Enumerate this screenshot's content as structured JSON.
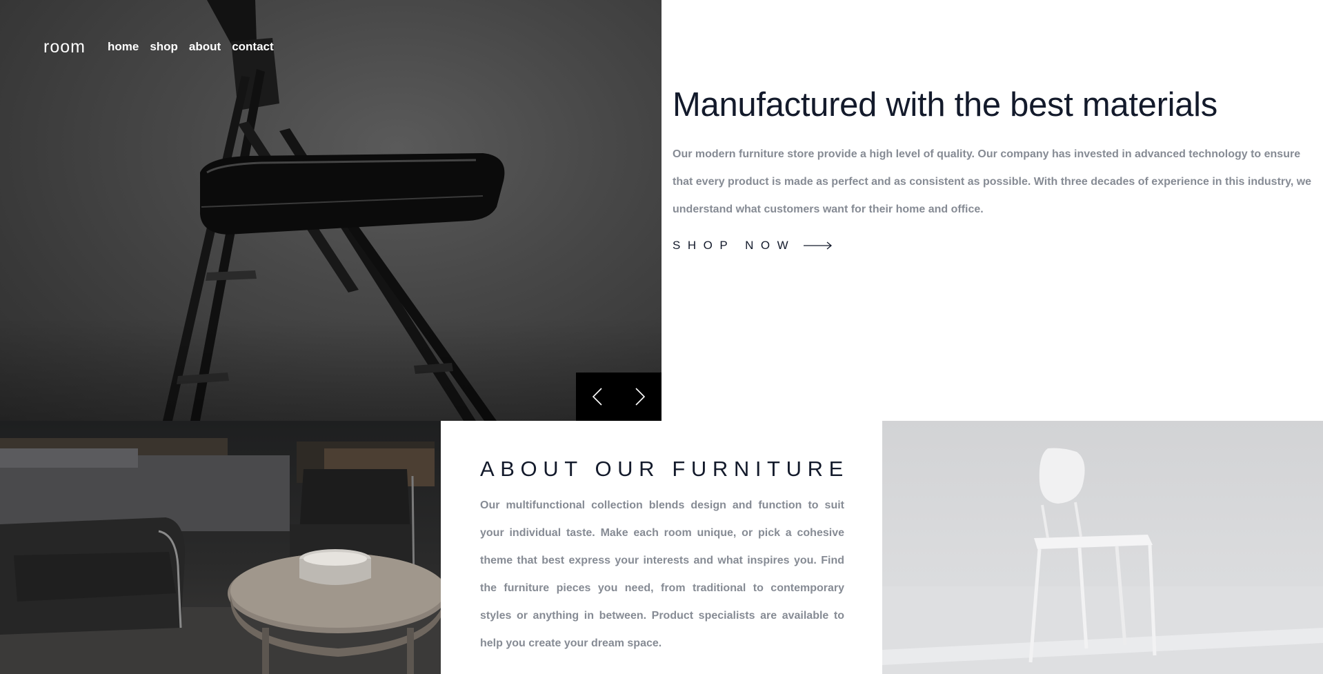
{
  "header": {
    "logo": "room",
    "nav": [
      "home",
      "shop",
      "about",
      "contact"
    ]
  },
  "hero": {
    "title": "Manufactured with the best materials",
    "description": "Our modern furniture store provide a high level of quality. Our company has invested in advanced technology to ensure that every product is made as perfect and as consistent as possible. With three decades of experience in this industry, we understand what customers want for their home and office.",
    "cta_label": "SHOP NOW"
  },
  "about": {
    "title": "ABOUT OUR FURNITURE",
    "description": "Our multifunctional collection blends design and function to suit your individual taste. Make each room unique, or pick a cohesive theme that best express your interests and what inspires you. Find the furniture pieces you need, from traditional to contemporary styles or anything in between. Product specialists are available to help you create your dream space."
  },
  "icons": {
    "slider_prev": "chevron-left-icon",
    "slider_next": "chevron-right-icon",
    "cta_arrow": "arrow-right-icon"
  },
  "colors": {
    "heading": "#131a2b",
    "body_text": "#868b94",
    "slider_bg": "#000000"
  }
}
